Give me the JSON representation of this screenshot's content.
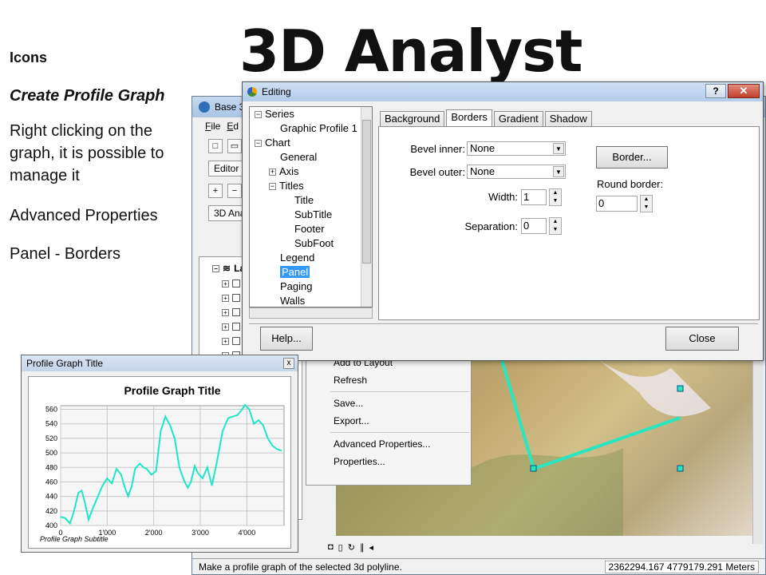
{
  "slide": {
    "title": "3D Analyst",
    "notes": {
      "icons": "Icons",
      "create": "Create Profile Graph",
      "right_click": "Right clicking on the graph, it is possible to manage it",
      "advanced": "Advanced Properties",
      "panel": "Panel - Borders"
    }
  },
  "main_window": {
    "title": "Base 3",
    "menu": [
      "File",
      "Ed"
    ],
    "editor_label": "Editor",
    "analyst_label": "3D Anal",
    "toc_header": "La",
    "status_text": "Make a profile graph of the selected 3d polyline.",
    "coords": "2362294.167  4779179.291 Meters"
  },
  "context_menu": {
    "items_group1": [
      "Add to Layout",
      "Refresh"
    ],
    "items_group2": [
      "Save...",
      "Export..."
    ],
    "items_group3": [
      "Advanced Properties...",
      "Properties..."
    ]
  },
  "editing_dialog": {
    "title": "Editing",
    "help_glyph": "?",
    "close_glyph": "✕",
    "tree": [
      {
        "label": "Series",
        "indent": 0,
        "toggle": "−"
      },
      {
        "label": "Graphic Profile 1",
        "indent": 1
      },
      {
        "label": "Chart",
        "indent": 0,
        "toggle": "−"
      },
      {
        "label": "General",
        "indent": 1
      },
      {
        "label": "Axis",
        "indent": 1,
        "toggle": "+"
      },
      {
        "label": "Titles",
        "indent": 1,
        "toggle": "−"
      },
      {
        "label": "Title",
        "indent": 2
      },
      {
        "label": "SubTitle",
        "indent": 2
      },
      {
        "label": "Footer",
        "indent": 2
      },
      {
        "label": "SubFoot",
        "indent": 2
      },
      {
        "label": "Legend",
        "indent": 1
      },
      {
        "label": "Panel",
        "indent": 1,
        "selected": true
      },
      {
        "label": "Paging",
        "indent": 1
      },
      {
        "label": "Walls",
        "indent": 1
      }
    ],
    "tabs": [
      "Background",
      "Borders",
      "Gradient",
      "Shadow"
    ],
    "active_tab": "Borders",
    "bevel_inner_label": "Bevel inner:",
    "bevel_inner_value": "None",
    "bevel_outer_label": "Bevel outer:",
    "bevel_outer_value": "None",
    "width_label": "Width:",
    "width_value": "1",
    "separation_label": "Separation:",
    "separation_value": "0",
    "border_button": "Border...",
    "round_border_label": "Round border:",
    "round_border_value": "0",
    "help_button": "Help...",
    "close_button": "Close"
  },
  "profile_window": {
    "title": "Profile Graph Title",
    "close_glyph": "x",
    "chart_data": {
      "type": "line",
      "title": "Profile Graph Title",
      "subtitle": "Profile Graph Subtitle",
      "xlabel": "",
      "ylabel": "",
      "xlim": [
        0,
        4800
      ],
      "ylim": [
        400,
        565
      ],
      "x_ticks": [
        "0",
        "1'000",
        "2'000",
        "3'000",
        "4'000"
      ],
      "x_tick_values": [
        0,
        1000,
        2000,
        3000,
        4000
      ],
      "y_ticks": [
        400,
        420,
        440,
        460,
        480,
        500,
        520,
        540,
        560
      ],
      "grid": true,
      "series": [
        {
          "color": "#1ee6c8",
          "x": [
            0,
            100,
            200,
            280,
            380,
            450,
            520,
            600,
            700,
            800,
            900,
            1000,
            1100,
            1200,
            1300,
            1380,
            1450,
            1530,
            1600,
            1650,
            1700,
            1780,
            1850,
            1950,
            2050,
            2150,
            2250,
            2350,
            2450,
            2550,
            2650,
            2730,
            2800,
            2880,
            2950,
            3050,
            3150,
            3250,
            3350,
            3480,
            3600,
            3700,
            3800,
            3900,
            3960,
            4050,
            4150,
            4250,
            4350,
            4450,
            4550,
            4650,
            4750
          ],
          "y": [
            412,
            410,
            403,
            418,
            445,
            448,
            432,
            408,
            425,
            440,
            455,
            465,
            458,
            478,
            470,
            452,
            440,
            455,
            478,
            482,
            485,
            480,
            478,
            470,
            475,
            530,
            550,
            538,
            520,
            480,
            462,
            452,
            460,
            482,
            472,
            465,
            480,
            455,
            485,
            530,
            548,
            550,
            552,
            560,
            566,
            560,
            540,
            545,
            538,
            520,
            510,
            505,
            503
          ]
        }
      ]
    }
  },
  "colors": {
    "profile_line": "#1ee6c8",
    "selection": "#3399ff"
  }
}
